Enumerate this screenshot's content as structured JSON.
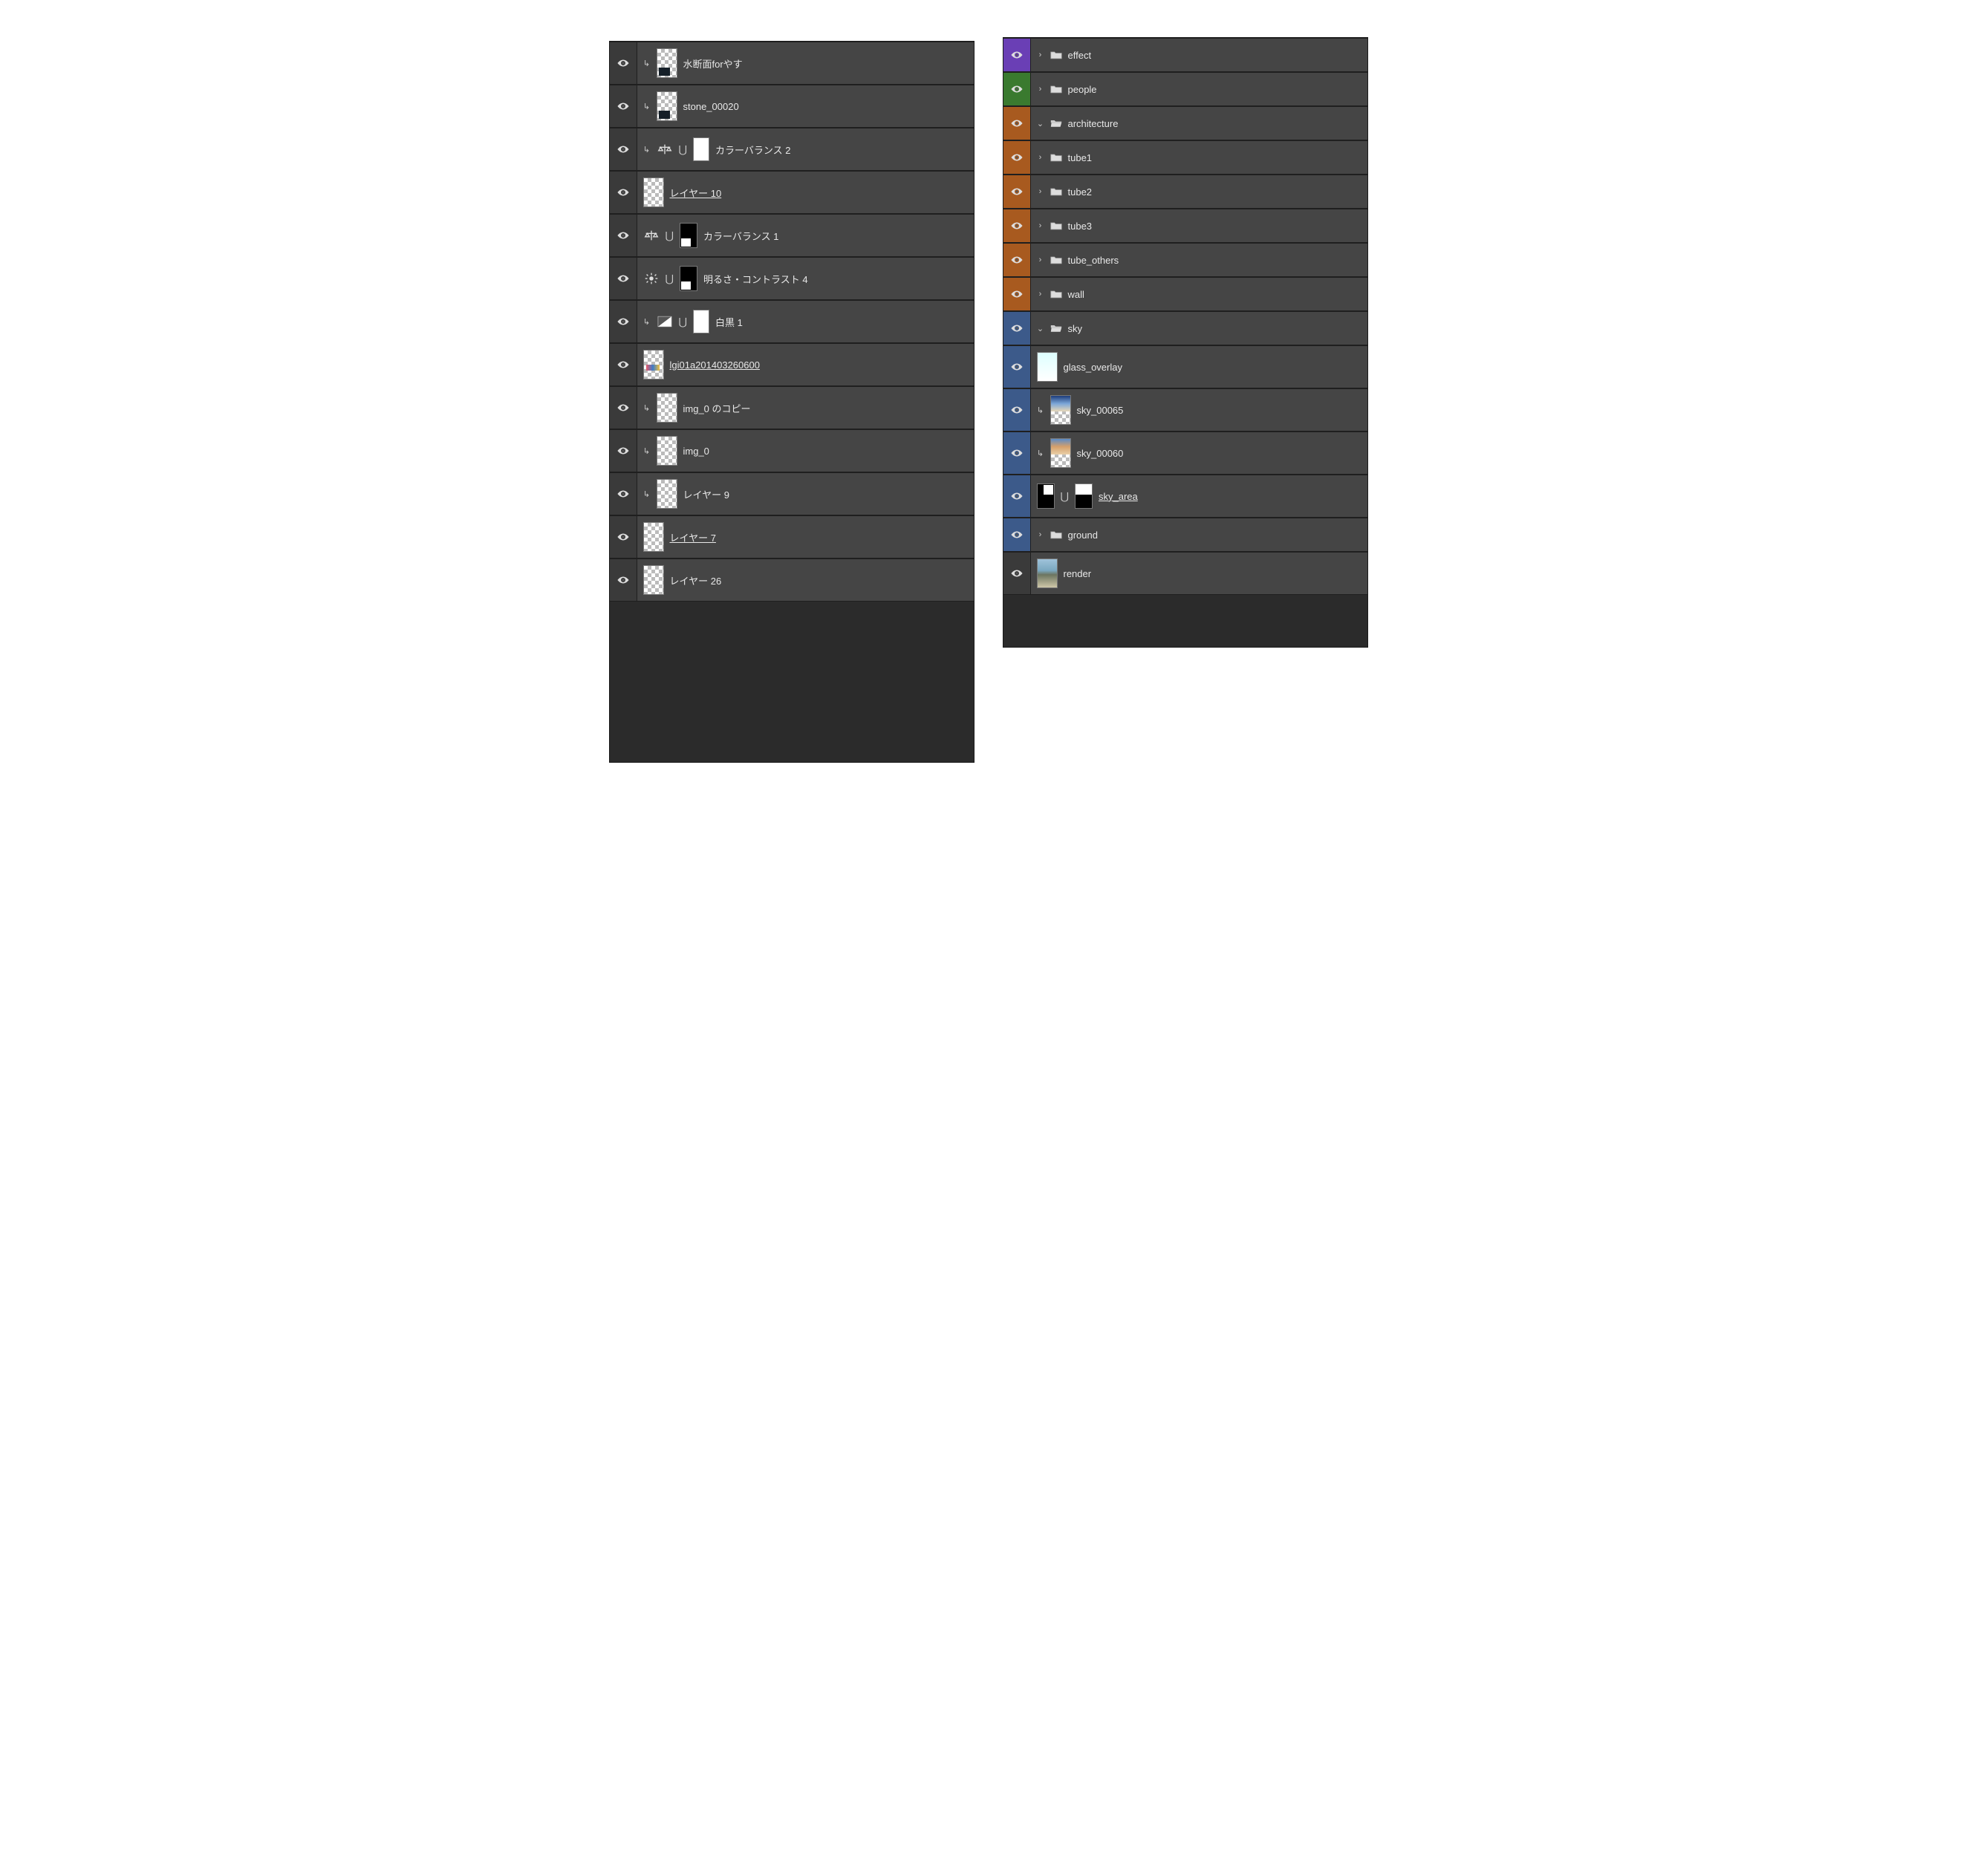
{
  "left_panel": {
    "rows": [
      {
        "name": "水断面forやす",
        "clip": true,
        "thumb": "checker-bm",
        "underline": false
      },
      {
        "name": "stone_00020",
        "clip": true,
        "thumb": "checker-bm",
        "underline": false
      },
      {
        "name": "カラーバランス 2",
        "clip": true,
        "adj": "balance",
        "mask": "white",
        "underline": false,
        "link": true
      },
      {
        "name": "レイヤー 10",
        "thumb": "checker",
        "underline": true
      },
      {
        "name": "カラーバランス 1",
        "adj": "balance",
        "thumb_mask": "black-s1",
        "underline": false,
        "link": true
      },
      {
        "name": "明るさ・コントラスト 4",
        "adj": "brightness",
        "thumb_mask": "black-s1",
        "underline": false,
        "link": true
      },
      {
        "name": "白黒 1",
        "clip": true,
        "adj": "bw",
        "mask": "white",
        "underline": false,
        "link": true
      },
      {
        "name": "lgi01a201403260600",
        "thumb": "checker-colors",
        "underline": true
      },
      {
        "name": "img_0 のコピー",
        "clip": true,
        "thumb": "checker",
        "underline": false
      },
      {
        "name": "img_0",
        "clip": true,
        "thumb": "checker",
        "underline": false
      },
      {
        "name": "レイヤー 9",
        "clip": true,
        "thumb": "checker",
        "underline": false
      },
      {
        "name": "レイヤー 7",
        "thumb": "checker",
        "underline": true
      },
      {
        "name": "レイヤー 26",
        "thumb": "checker",
        "underline": false
      }
    ]
  },
  "right_panel": {
    "rows": [
      {
        "type": "folder",
        "name": "effect",
        "color": "purple",
        "open": false,
        "indent": 0
      },
      {
        "type": "folder",
        "name": "people",
        "color": "green",
        "open": false,
        "indent": 0
      },
      {
        "type": "folder",
        "name": "architecture",
        "color": "orange",
        "open": true,
        "indent": 0
      },
      {
        "type": "folder",
        "name": "tube1",
        "color": "orange",
        "open": false,
        "indent": 1
      },
      {
        "type": "folder",
        "name": "tube2",
        "color": "orange",
        "open": false,
        "indent": 1
      },
      {
        "type": "folder",
        "name": "tube3",
        "color": "orange",
        "open": false,
        "indent": 1
      },
      {
        "type": "folder",
        "name": "tube_others",
        "color": "orange",
        "open": false,
        "indent": 1
      },
      {
        "type": "folder",
        "name": "wall",
        "color": "orange",
        "open": false,
        "indent": 1
      },
      {
        "type": "folder",
        "name": "sky",
        "color": "blue",
        "open": true,
        "indent": 0
      },
      {
        "type": "layer",
        "name": "glass_overlay",
        "color": "blue",
        "thumb": "sky",
        "indent": 1
      },
      {
        "type": "layer",
        "name": "sky_00065",
        "color": "blue",
        "clip": true,
        "thumb": "photo1-checker",
        "indent": 1
      },
      {
        "type": "layer",
        "name": "sky_00060",
        "color": "blue",
        "clip": true,
        "thumb": "photo2-checker",
        "indent": 1
      },
      {
        "type": "layer",
        "name": "sky_area",
        "color": "blue",
        "underline": true,
        "double_mask": true,
        "indent": 1
      },
      {
        "type": "folder",
        "name": "ground",
        "color": "blue",
        "open": false,
        "indent": 0
      },
      {
        "type": "layer",
        "name": "render",
        "color": "dark",
        "thumb": "render",
        "indent": 0
      }
    ]
  }
}
